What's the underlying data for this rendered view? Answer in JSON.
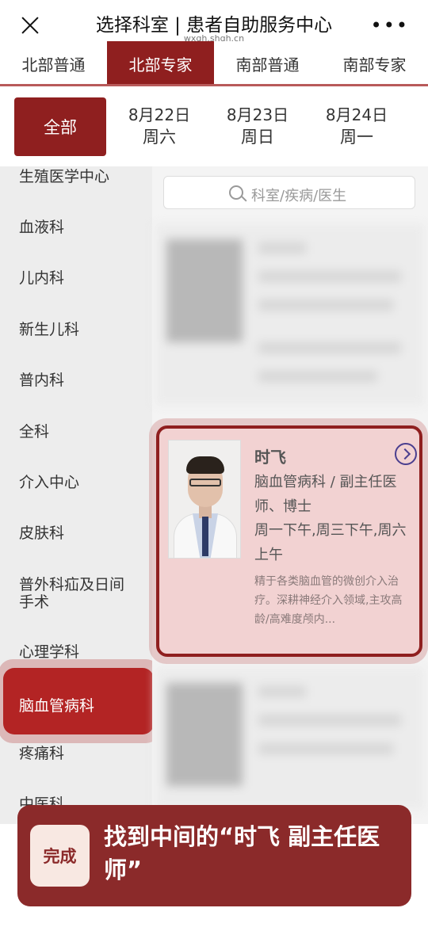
{
  "header": {
    "title": "选择科室 | 患者自助服务中心",
    "url": "wxgh.shgh.cn",
    "close_icon": "close-icon",
    "more_label": "•••"
  },
  "tabs": [
    {
      "label": "北部普通",
      "active": false
    },
    {
      "label": "北部专家",
      "active": true
    },
    {
      "label": "南部普通",
      "active": false
    },
    {
      "label": "南部专家",
      "active": false
    }
  ],
  "dates": {
    "all_label": "全部",
    "items": [
      {
        "date": "8月22日",
        "weekday": "周六"
      },
      {
        "date": "8月23日",
        "weekday": "周日"
      },
      {
        "date": "8月24日",
        "weekday": "周一"
      }
    ]
  },
  "sidebar": {
    "items": [
      "生殖医学中心",
      "血液科",
      "儿内科",
      "新生儿科",
      "普内科",
      "全科",
      "介入中心",
      "皮肤科",
      "普外科疝及日间手术",
      "心理学科",
      "脑血管病科",
      "疼痛科",
      "中医科"
    ],
    "active_label": "脑血管病科"
  },
  "search": {
    "placeholder": "科室/疾病/医生"
  },
  "doctor": {
    "name": "时飞",
    "dept_title": "脑血管病科 / 副主任医师、博士",
    "schedule": "周一下午,周三下午,周六上午",
    "description": "精于各类脑血管的微创介入治疗。深耕神经介入领域,主攻高龄/高难度颅内..."
  },
  "banner": {
    "done_label": "完成",
    "text": "找到中间的“时飞 副主任医师”"
  },
  "colors": {
    "brand": "#8f1f1f",
    "sidebar_bg": "#ededed",
    "card_bg": "#f2d2d2",
    "banner_bg": "#8b2a2a"
  }
}
